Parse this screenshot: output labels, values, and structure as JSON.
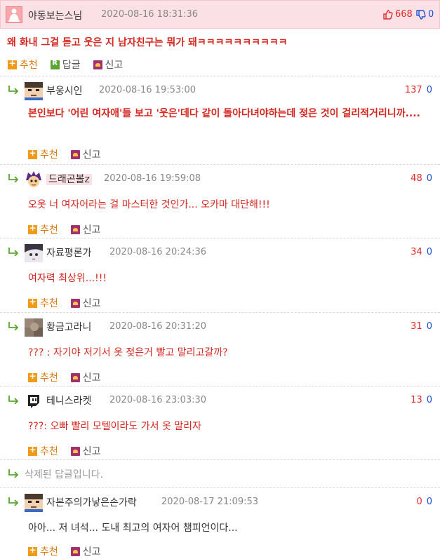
{
  "main": {
    "nickname": "야동보는스님",
    "date": "2020-08-16 18:31:36",
    "upvotes": "668",
    "downvotes": "0",
    "body": "왜 화내 그걸 듣고 웃은 지 남자친구는 뭐가 돼ㅋㅋㅋㅋㅋㅋㅋㅋㅋㅋ",
    "actions": {
      "recommend": "추천",
      "reply": "답글",
      "report": "신고"
    }
  },
  "replies": [
    {
      "nickname": "부웅시인",
      "date": "2020-08-16 19:53:00",
      "upvotes": "137",
      "downvotes": "0",
      "body": "본인보다 '어린 여자애'들 보고 '웃은'데다 같이 돌아다녀야하는데 젖은 것이 걸리적거리니까....",
      "recommend": "추천",
      "report": "신고"
    },
    {
      "nickname": "드래곤볼z",
      "date": "2020-08-16 19:59:08",
      "upvotes": "48",
      "downvotes": "0",
      "body": "오옷 너 여자어라는 걸 마스터한 것인가... 오카마 대단해!!!",
      "recommend": "추천",
      "report": "신고"
    },
    {
      "nickname": "자료평론가",
      "date": "2020-08-16 20:24:36",
      "upvotes": "34",
      "downvotes": "0",
      "body": "여자력 최상위...!!!",
      "recommend": "추천",
      "report": "신고"
    },
    {
      "nickname": "황금고라니",
      "date": "2020-08-16 20:31:20",
      "upvotes": "31",
      "downvotes": "0",
      "body": "??? : 자기야 저기서 옷 젖은거 빨고 말리고갈까?",
      "recommend": "추천",
      "report": "신고"
    },
    {
      "nickname": "테니스라켓",
      "date": "2020-08-16 23:03:30",
      "upvotes": "13",
      "downvotes": "0",
      "body": "???: 오빠 빨리 모텔이라도 가서 옷 말리자",
      "recommend": "추천",
      "report": "신고"
    },
    {
      "deleted_text": "삭제된 답글입니다."
    },
    {
      "nickname": "자본주의가낳은손가락",
      "date": "2020-08-17 21:09:53",
      "upvotes": "0",
      "downvotes": "0",
      "body": "아아... 저 녀석... 도내 최고의 여자어 챔피언이다...",
      "recommend": "추천",
      "report": "신고"
    }
  ],
  "colors": {
    "accent_red": "#d6261f",
    "header_pink": "#fbe1e6",
    "recommend_orange": "#f19a1a",
    "down_blue": "#1b4fd6"
  }
}
